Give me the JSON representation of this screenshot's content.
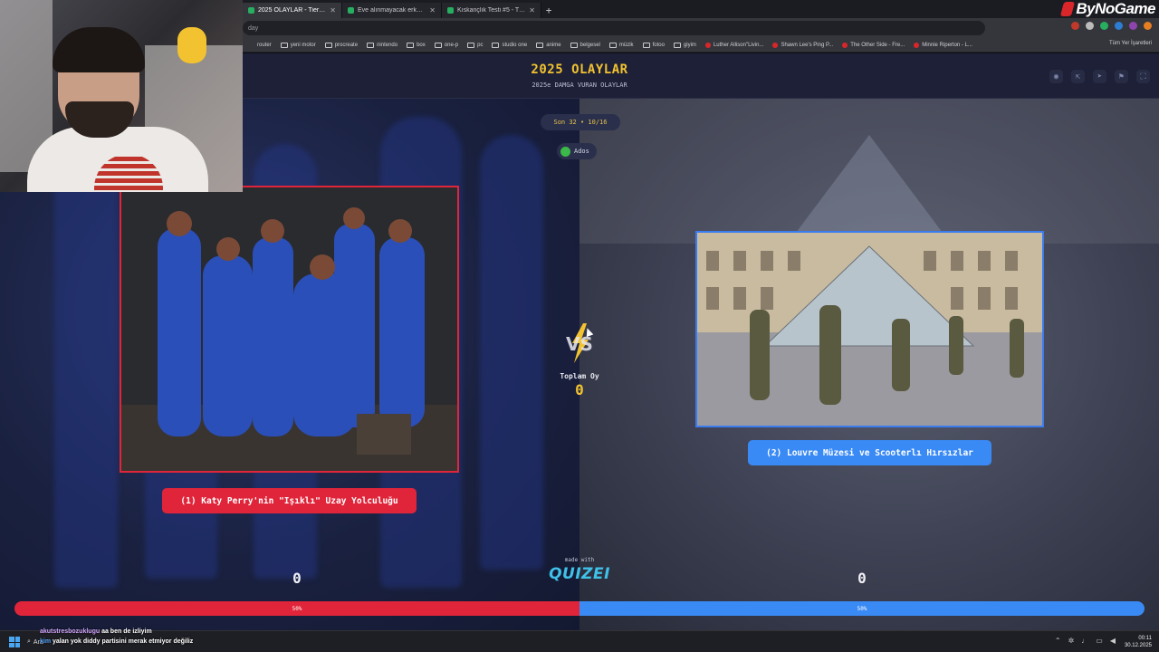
{
  "browser": {
    "tabs": [
      {
        "title": "2025 OLAYLAR - Tier List, Kör",
        "active": true
      },
      {
        "title": "Eve alınmayacak erkek ünlüler",
        "active": false
      },
      {
        "title": "Kıskançlık Testi #5 - Tier List | K",
        "active": false
      }
    ],
    "url": "day",
    "brand": "ByNoGame",
    "bookmarks": [
      "router",
      "yeni motor",
      "procreate",
      "nintendo",
      "box",
      "one-p",
      "pc",
      "studio one",
      "anime",
      "belgesel",
      "müzik",
      "fotoo",
      "giyim",
      "Luther Allison\"Livin...",
      "Shawn Lee's Ping P...",
      "The Other Side - Fre...",
      "Minnie Riperton - L..."
    ],
    "bookmarks_right": "Tüm Yer İşaretleri"
  },
  "page": {
    "title": "2025 OLAYLAR",
    "subtitle": "2025e DAMGA VURAN OLAYLAR",
    "round": "Son 32 • 10/16",
    "user": "Ados",
    "vs_text": "VS",
    "total_label": "Toplam Oy",
    "total_value": "0",
    "made_with": "made with",
    "logo": "QUIZEI",
    "left_option": "(1) Katy Perry'nin \"Işıklı\" Uzay Yolculuğu",
    "right_option": "(2) Louvre Müzesi ve Scooterlı Hırsızlar",
    "left_score": "0",
    "right_score": "0",
    "left_percent_label": "50%",
    "right_percent_label": "50%",
    "left_share": 0.5
  },
  "header_icons": [
    "eye-icon",
    "share-icon",
    "send-icon",
    "flag-icon",
    "fullscreen-icon"
  ],
  "colors": {
    "left": "#e0253a",
    "right": "#3a8af5",
    "accent": "#f2c230"
  },
  "chat": [
    {
      "user": "akutstresbozuklugu",
      "text": "aa ben de izliyim"
    },
    {
      "user": "kim",
      "text": "yalan yok diddy partisini merak etmiyor değiliz"
    }
  ],
  "taskbar": {
    "search": "Ara",
    "time": "00:11",
    "date": "30.12.2025"
  }
}
